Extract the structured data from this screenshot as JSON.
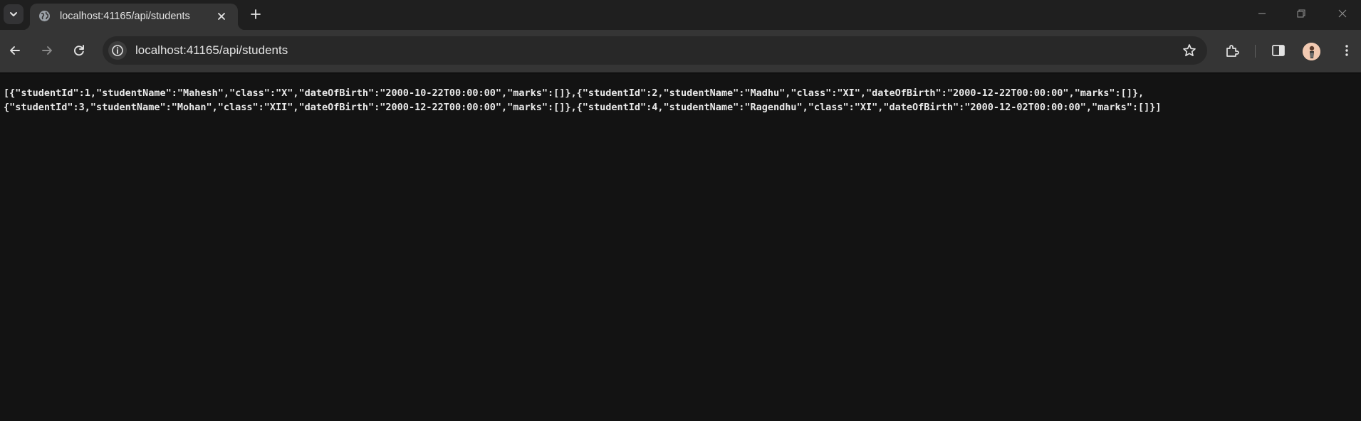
{
  "tab": {
    "title": "localhost:41165/api/students",
    "favicon": "globe-icon"
  },
  "omnibox": {
    "url": "localhost:41165/api/students"
  },
  "icons": {
    "tab_search": "chevron-down-icon",
    "tab_close": "close-icon",
    "new_tab": "plus-icon",
    "minimize": "minimize-icon",
    "restore": "restore-icon",
    "close_window": "close-icon",
    "back": "arrow-left-icon",
    "forward": "arrow-right-icon",
    "reload": "reload-icon",
    "site_info": "info-icon",
    "bookmark": "star-icon",
    "extensions": "puzzle-icon",
    "side_panel": "side-panel-icon",
    "profile": "avatar",
    "menu": "kebab-menu-icon"
  },
  "page": {
    "body_line_1": "[{\"studentId\":1,\"studentName\":\"Mahesh\",\"class\":\"X\",\"dateOfBirth\":\"2000-10-22T00:00:00\",\"marks\":[]},{\"studentId\":2,\"studentName\":\"Madhu\",\"class\":\"XI\",\"dateOfBirth\":\"2000-12-22T00:00:00\",\"marks\":[]},",
    "body_line_2": "{\"studentId\":3,\"studentName\":\"Mohan\",\"class\":\"XII\",\"dateOfBirth\":\"2000-12-22T00:00:00\",\"marks\":[]},{\"studentId\":4,\"studentName\":\"Ragendhu\",\"class\":\"XI\",\"dateOfBirth\":\"2000-12-02T00:00:00\",\"marks\":[]}]"
  },
  "colors": {
    "tabstrip_bg": "#1f1f1f",
    "toolbar_bg": "#353535",
    "omnibox_bg": "#282828",
    "page_bg": "#131313",
    "text": "#e8e8e8"
  }
}
